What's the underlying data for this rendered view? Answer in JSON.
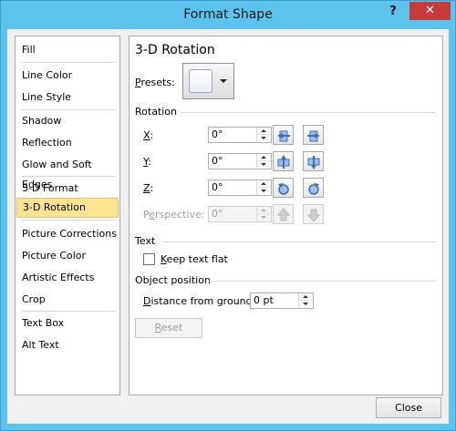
{
  "window": {
    "title": "Format Shape",
    "help_label": "?",
    "close_label": "✕"
  },
  "nav": {
    "items": [
      {
        "label": "Fill"
      },
      {
        "label": "Line Color"
      },
      {
        "label": "Line Style"
      },
      {
        "label": "Shadow"
      },
      {
        "label": "Reflection"
      },
      {
        "label": "Glow and Soft Edges"
      },
      {
        "label": "3-D Format"
      },
      {
        "label": "3-D Rotation",
        "selected": true
      },
      {
        "label": "Picture Corrections"
      },
      {
        "label": "Picture Color"
      },
      {
        "label": "Artistic Effects"
      },
      {
        "label": "Crop"
      },
      {
        "label": "Text Box"
      },
      {
        "label": "Alt Text"
      }
    ]
  },
  "panel": {
    "title": "3-D Rotation",
    "presets": {
      "label_u": "P",
      "label_rest": "resets:"
    },
    "rotation": {
      "heading": "Rotation",
      "x": {
        "label_u": "X",
        "label_rest": ":",
        "value": "0°"
      },
      "y": {
        "label_u": "Y",
        "label_rest": ":",
        "value": "0°"
      },
      "z": {
        "label_u": "Z",
        "label_rest": ":",
        "value": "0°"
      },
      "perspective": {
        "label_pre": "P",
        "label_u": "e",
        "label_rest": "rspective:",
        "value": "0°",
        "disabled": true
      }
    },
    "text": {
      "heading": "Text",
      "keep_flat": {
        "label_u": "K",
        "label_rest": "eep text flat",
        "checked": false
      }
    },
    "object_position": {
      "heading": "Object position",
      "distance": {
        "label_u": "D",
        "label_rest": "istance from ground:",
        "value": "0 pt"
      }
    },
    "reset": {
      "label_u": "R",
      "label_rest": "eset",
      "disabled": true
    }
  },
  "footer": {
    "close_label": "Close"
  },
  "icons": {
    "x_left": "rotate-left-icon",
    "x_right": "rotate-right-icon",
    "y_up": "rotate-up-icon",
    "y_down": "rotate-down-icon",
    "z_ccw": "rotate-counterclockwise-icon",
    "z_cw": "rotate-clockwise-icon",
    "persp_narrow": "narrow-perspective-icon",
    "persp_widen": "widen-perspective-icon"
  },
  "colors": {
    "title_bar": "#5cc3ec",
    "close_button": "#c73b3b",
    "selected_item": "#fce38f",
    "icon_blue": "#3f6fb5"
  }
}
